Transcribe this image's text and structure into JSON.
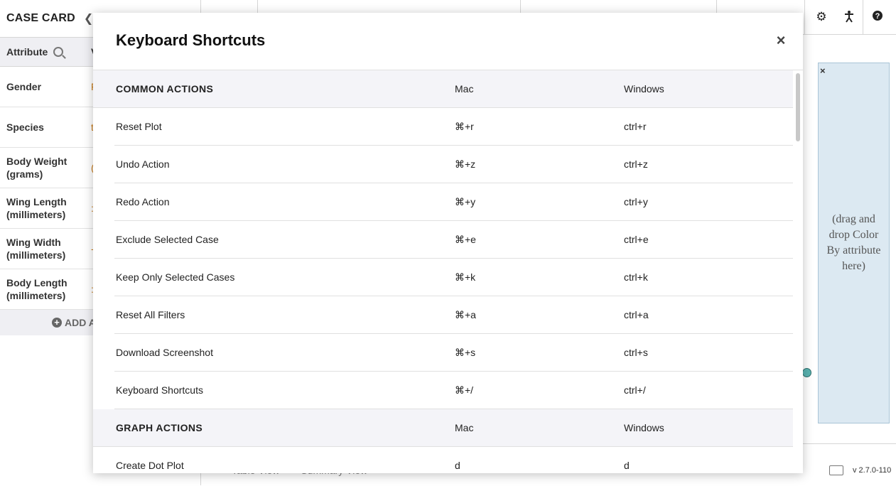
{
  "case_card": {
    "title": "CASE CARD",
    "collapse_glyph": "❮",
    "attribute_header": "Attribute",
    "value_header": "V",
    "attributes": [
      {
        "label": "Gender",
        "value": "F"
      },
      {
        "label": "Species",
        "value": "t"
      },
      {
        "label": "Body Weight (grams)",
        "value": "("
      },
      {
        "label": "Wing Length (millimeters)",
        "value": ":"
      },
      {
        "label": "Wing Width (millimeters)",
        "value": "-"
      },
      {
        "label": "Body Length (millimeters)",
        "value": ":"
      }
    ],
    "add_attribute": "ADD A"
  },
  "graph": {
    "drop_zone_text": "(drag and drop Color By attribute here)",
    "drop_zone_close": "×",
    "bottom_tabs": [
      "Table View",
      "Summary View"
    ],
    "version": "v 2.7.0-110"
  },
  "toolbar": {
    "icons": [
      "settings-icon",
      "accessibility-icon",
      "help-icon"
    ],
    "settings_glyph": "⚙",
    "accessibility_glyph": "⚲",
    "help_glyph": "?"
  },
  "modal": {
    "title": "Keyboard Shortcuts",
    "close_glyph": "×",
    "sections": [
      {
        "name": "COMMON ACTIONS",
        "mac_header": "Mac",
        "windows_header": "Windows",
        "rows": [
          {
            "action": "Reset Plot",
            "mac": "⌘+r",
            "windows": "ctrl+r"
          },
          {
            "action": "Undo Action",
            "mac": "⌘+z",
            "windows": "ctrl+z"
          },
          {
            "action": "Redo Action",
            "mac": "⌘+y",
            "windows": "ctrl+y"
          },
          {
            "action": "Exclude Selected Case",
            "mac": "⌘+e",
            "windows": "ctrl+e"
          },
          {
            "action": "Keep Only Selected Cases",
            "mac": "⌘+k",
            "windows": "ctrl+k"
          },
          {
            "action": "Reset All Filters",
            "mac": "⌘+a",
            "windows": "ctrl+a"
          },
          {
            "action": "Download Screenshot",
            "mac": "⌘+s",
            "windows": "ctrl+s"
          },
          {
            "action": "Keyboard Shortcuts",
            "mac": "⌘+/",
            "windows": "ctrl+/"
          }
        ]
      },
      {
        "name": "GRAPH ACTIONS",
        "mac_header": "Mac",
        "windows_header": "Windows",
        "rows": [
          {
            "action": "Create Dot Plot",
            "mac": "d",
            "windows": "d"
          }
        ]
      }
    ]
  }
}
